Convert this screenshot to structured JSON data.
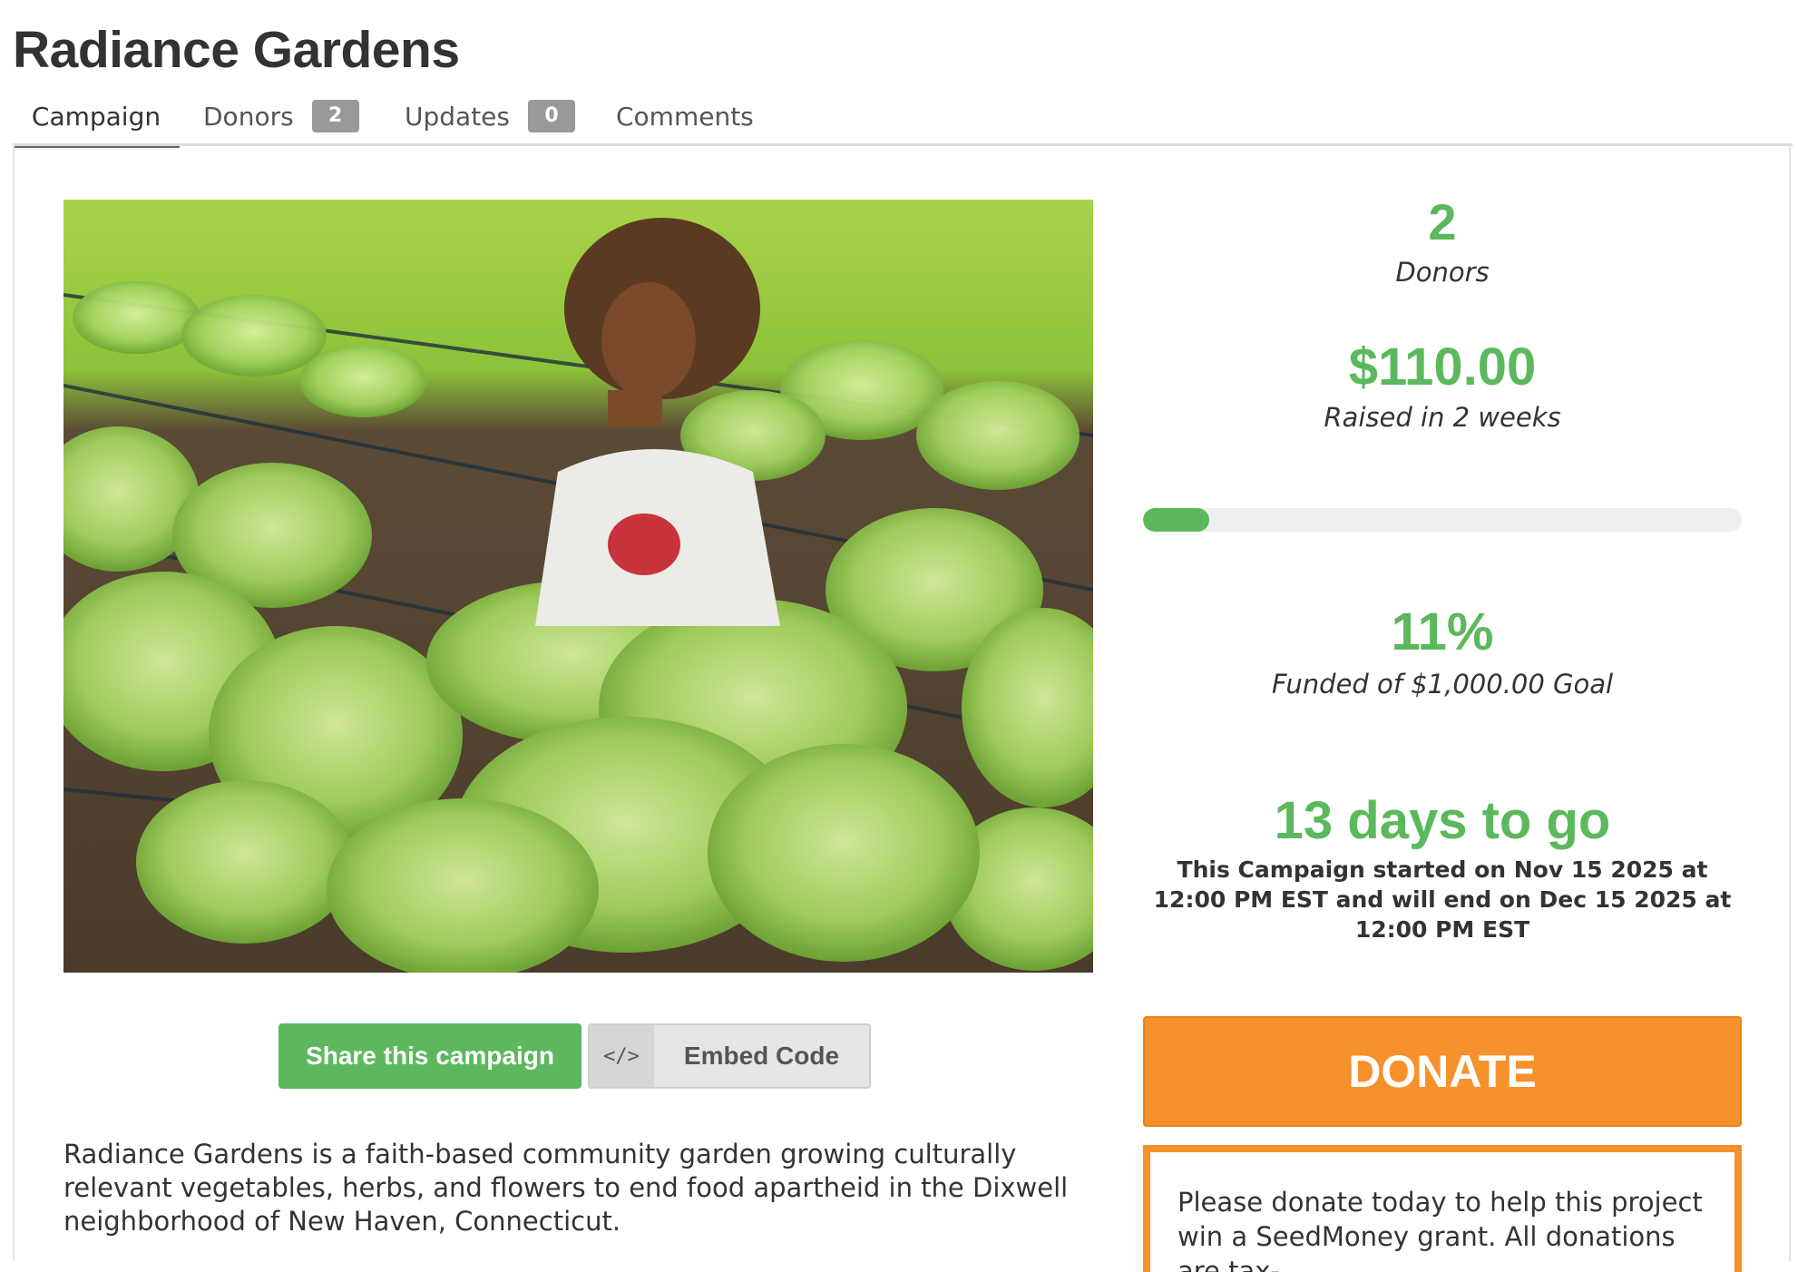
{
  "campaign": {
    "title": "Radiance Gardens"
  },
  "tabs": [
    {
      "label": "Campaign",
      "active": true
    },
    {
      "label": "Donors",
      "count": "2"
    },
    {
      "label": "Updates",
      "count": "0"
    },
    {
      "label": "Comments"
    }
  ],
  "stats": {
    "donors_count": "2",
    "donors_label": "Donors",
    "raised_amount": "$110.00",
    "raised_label": "Raised in 2 weeks",
    "progress_fraction": 0.11,
    "funded_percent": "11%",
    "funded_label": "Funded of $1,000.00 Goal",
    "days_to_go": "13 days to go",
    "schedule_text": "This Campaign started on Nov 15 2025 at 12:00 PM EST and will end on Dec 15 2025 at 12:00 PM EST"
  },
  "actions": {
    "share_label": "Share this campaign",
    "embed_icon": "</>",
    "embed_label": "Embed Code",
    "donate_label": "DONATE"
  },
  "description": "Radiance Gardens is a faith-based community garden growing culturally relevant vegetables, herbs, and flowers to end food apartheid in the Dixwell neighborhood of New Haven, Connecticut.",
  "donate_notice": "Please donate today to help this project win a SeedMoney grant. All donations are tax-",
  "colors": {
    "accent_green": "#5cb85c",
    "donate_orange": "#f7912b"
  }
}
